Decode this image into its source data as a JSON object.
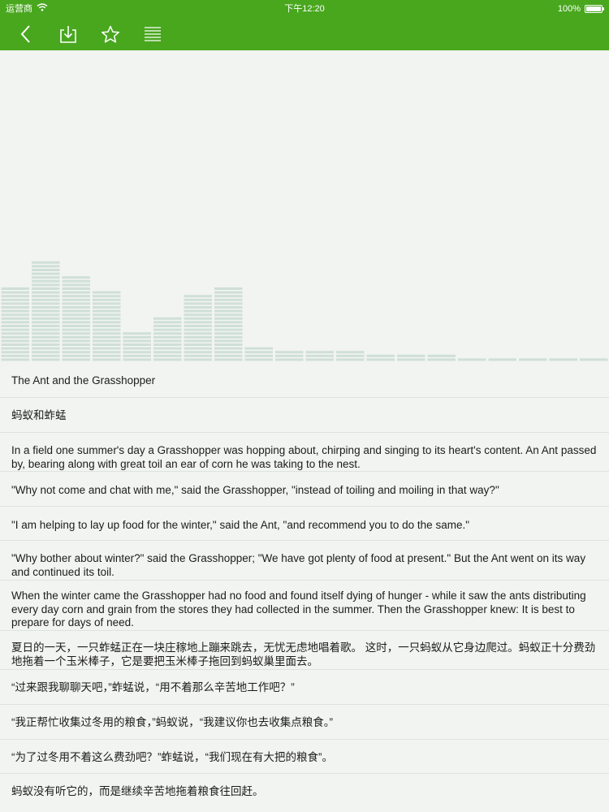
{
  "status_bar": {
    "carrier": "运营商",
    "time": "下午12:20",
    "battery": "100%"
  },
  "toolbar": {
    "back": "chevron-left-icon",
    "download": "download-icon",
    "favorite": "star-icon",
    "menu": "list-icon"
  },
  "colors": {
    "toolbar": "#49a71e",
    "bars": "#cfe0d6",
    "background": "#f2f4f1"
  },
  "chart_data": {
    "type": "bar",
    "values": [
      10,
      13.5,
      11.5,
      9.5,
      4,
      6,
      9,
      10,
      2,
      1.5,
      1.5,
      1.5,
      1,
      1,
      1,
      0.5,
      0.5,
      0.5,
      0.5,
      0.5
    ],
    "ylim": [
      0,
      30
    ]
  },
  "paragraphs": [
    "The Ant and the Grasshopper",
    "蚂蚁和蚱蜢",
    "In a field one summer's day a Grasshopper was hopping about, chirping and singing to its heart's content. An Ant passed by, bearing along with great toil an ear of corn he was taking to the nest.",
    " \"Why not come and chat with me,\" said the Grasshopper, \"instead of toiling and moiling in that way?\"",
    " \"I am helping to lay up food for the winter,\" said the Ant, \"and recommend you to do the same.\"",
    " \"Why bother about winter?\" said the Grasshopper; \"We have got plenty of food at present.\" But the Ant went on its way and continued its toil.",
    " When the winter came the Grasshopper had no food and found itself dying of hunger - while it saw the ants distributing every day corn and grain from the stores they had collected in the summer. Then the Grasshopper knew: It is best to prepare for days of need.",
    "夏日的一天，一只蚱蜢正在一块庄稼地上蹦来跳去，无忧无虑地唱着歌。 这时，一只蚂蚁从它身边爬过。蚂蚁正十分费劲地拖着一个玉米棒子，它是要把玉米棒子拖回到蚂蚁巢里面去。",
    "“过来跟我聊聊天吧，”蚱蜢说，“用不着那么辛苦地工作吧？”",
    "“我正帮忙收集过冬用的粮食，”蚂蚁说，“我建议你也去收集点粮食。”",
    "“为了过冬用不着这么费劲吧？”蚱蜢说，“我们现在有大把的粮食”。",
    "蚂蚁没有听它的，而是继续辛苦地拖着粮食往回赶。"
  ]
}
